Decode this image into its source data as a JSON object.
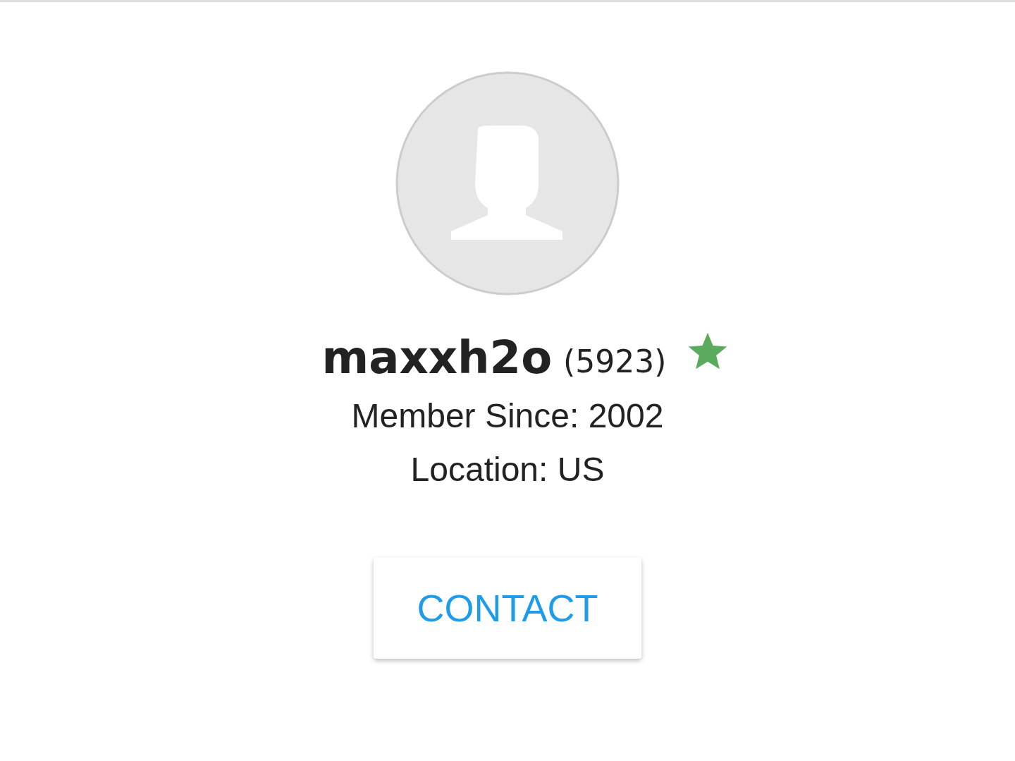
{
  "profile": {
    "username": "maxxh2o",
    "feedback_count": "(5923)",
    "member_since": "Member Since: 2002",
    "location": "Location: US"
  },
  "contact_button": {
    "label": "CONTACT"
  }
}
